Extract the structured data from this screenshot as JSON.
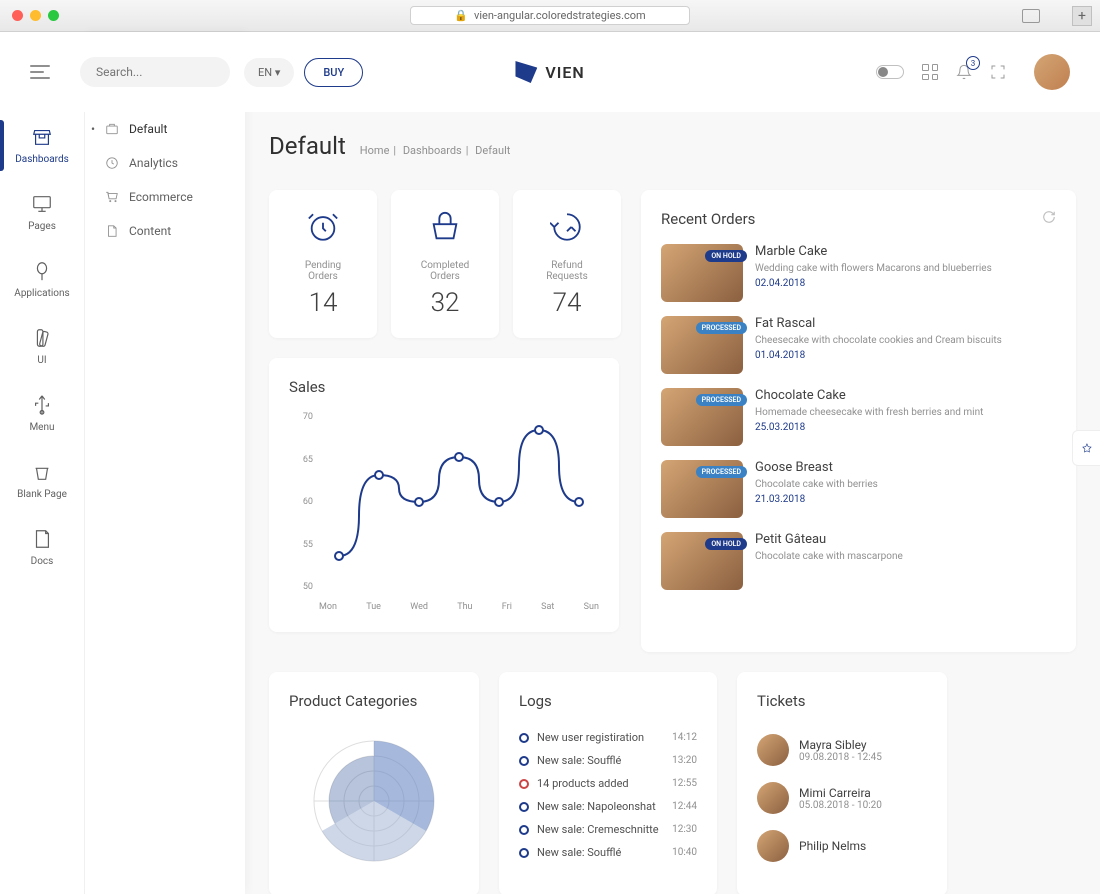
{
  "browser": {
    "url": "vien-angular.coloredstrategies.com"
  },
  "topbar": {
    "search_placeholder": "Search...",
    "lang": "EN ▾",
    "buy": "BUY",
    "brand": "VIEN",
    "notification_count": "3"
  },
  "sidebar": {
    "items": [
      {
        "label": "Dashboards"
      },
      {
        "label": "Pages"
      },
      {
        "label": "Applications"
      },
      {
        "label": "UI"
      },
      {
        "label": "Menu"
      },
      {
        "label": "Blank Page"
      },
      {
        "label": "Docs"
      }
    ]
  },
  "submenu": {
    "items": [
      {
        "label": "Default"
      },
      {
        "label": "Analytics"
      },
      {
        "label": "Ecommerce"
      },
      {
        "label": "Content"
      }
    ]
  },
  "page": {
    "title": "Default",
    "crumb_home": "Home",
    "crumb_dash": "Dashboards",
    "crumb_current": "Default"
  },
  "stats": [
    {
      "label": "Pending Orders",
      "value": "14"
    },
    {
      "label": "Completed Orders",
      "value": "32"
    },
    {
      "label": "Refund Requests",
      "value": "74"
    }
  ],
  "recent_orders": {
    "title": "Recent Orders",
    "items": [
      {
        "title": "Marble Cake",
        "desc": "Wedding cake with flowers Macarons and blueberries",
        "date": "02.04.2018",
        "badge": "ON HOLD",
        "badge_class": "badge-hold"
      },
      {
        "title": "Fat Rascal",
        "desc": "Cheesecake with chocolate cookies and Cream biscuits",
        "date": "01.04.2018",
        "badge": "PROCESSED",
        "badge_class": "badge-processed"
      },
      {
        "title": "Chocolate Cake",
        "desc": "Homemade cheesecake with fresh berries and mint",
        "date": "25.03.2018",
        "badge": "PROCESSED",
        "badge_class": "badge-processed"
      },
      {
        "title": "Goose Breast",
        "desc": "Chocolate cake with berries",
        "date": "21.03.2018",
        "badge": "PROCESSED",
        "badge_class": "badge-processed"
      },
      {
        "title": "Petit Gâteau",
        "desc": "Chocolate cake with mascarpone",
        "date": "",
        "badge": "ON HOLD",
        "badge_class": "badge-hold"
      }
    ]
  },
  "sales": {
    "title": "Sales"
  },
  "chart_data": {
    "type": "line",
    "categories": [
      "Mon",
      "Tue",
      "Wed",
      "Thu",
      "Fri",
      "Sat",
      "Sun"
    ],
    "values": [
      54,
      63,
      60,
      65,
      60,
      68,
      60
    ],
    "title": "Sales",
    "xlabel": "",
    "ylabel": "",
    "ylim": [
      50,
      70
    ],
    "yticks": [
      50,
      55,
      60,
      65,
      70
    ]
  },
  "categories": {
    "title": "Product Categories"
  },
  "logs": {
    "title": "Logs",
    "items": [
      {
        "text": "New user registiration",
        "time": "14:12",
        "red": false
      },
      {
        "text": "New sale: Soufflé",
        "time": "13:20",
        "red": false
      },
      {
        "text": "14 products added",
        "time": "12:55",
        "red": true
      },
      {
        "text": "New sale: Napoleonshat",
        "time": "12:44",
        "red": false
      },
      {
        "text": "New sale: Cremeschnitte",
        "time": "12:30",
        "red": false
      },
      {
        "text": "New sale: Soufflé",
        "time": "10:40",
        "red": false
      }
    ]
  },
  "tickets": {
    "title": "Tickets",
    "items": [
      {
        "name": "Mayra Sibley",
        "date": "09.08.2018 - 12:45"
      },
      {
        "name": "Mimi Carreira",
        "date": "05.08.2018 - 10:20"
      },
      {
        "name": "Philip Nelms",
        "date": ""
      }
    ]
  }
}
